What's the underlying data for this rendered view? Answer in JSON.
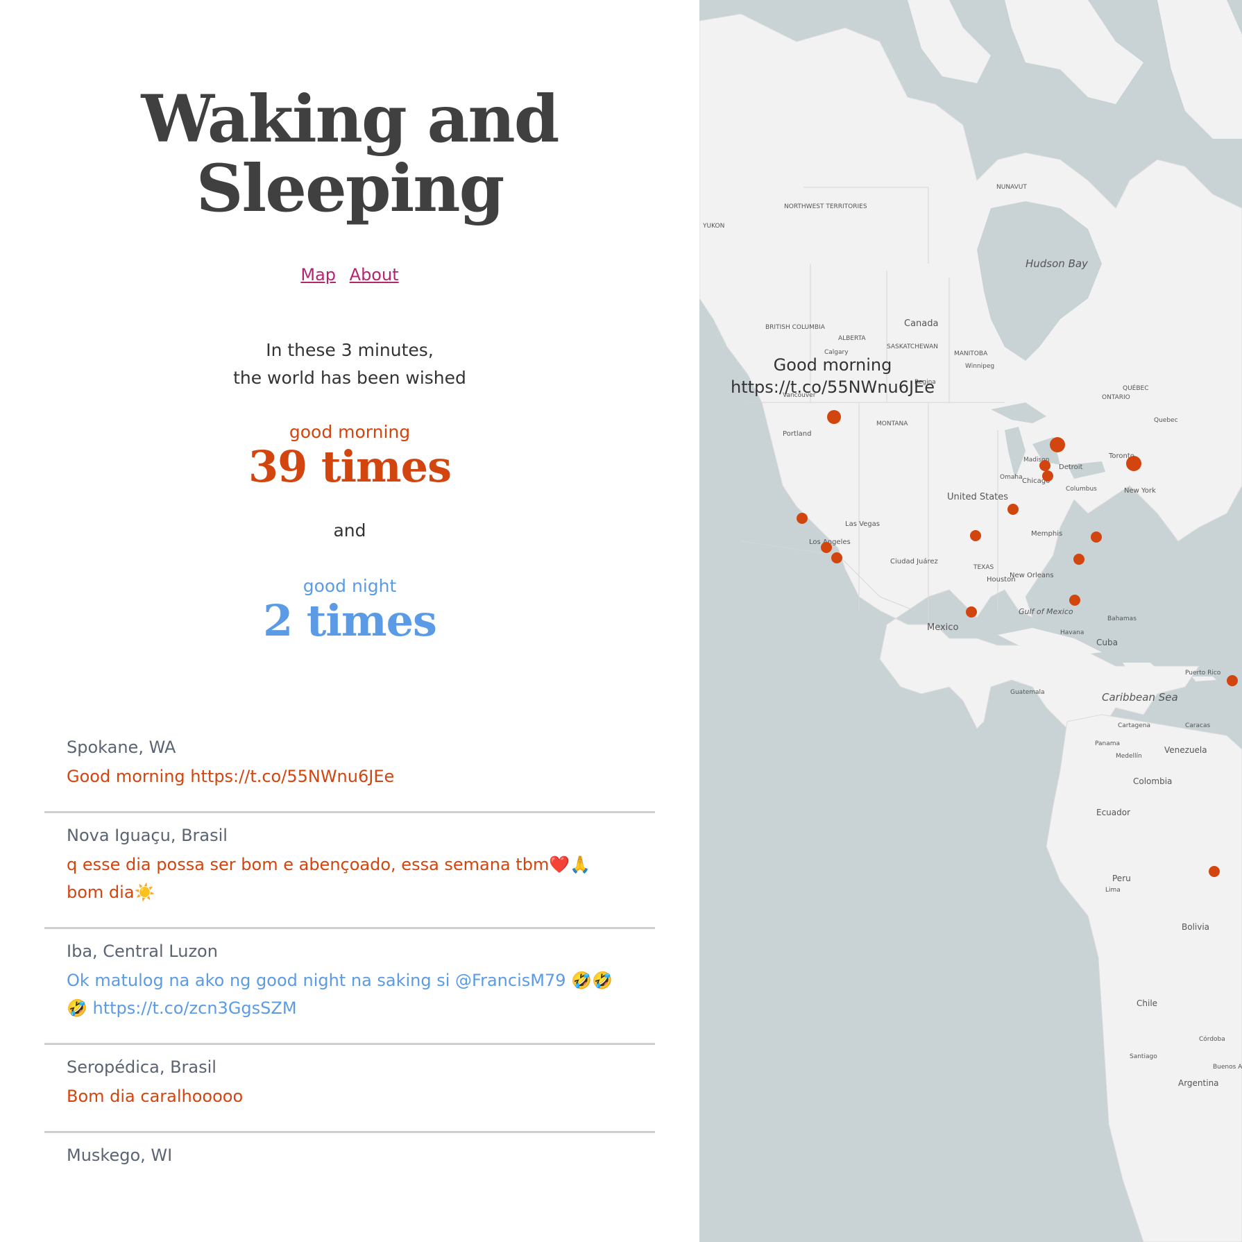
{
  "page": {
    "title_line1": "Waking and",
    "title_line2": "Sleeping",
    "nav": {
      "map": "Map",
      "about": "About"
    },
    "intro_line1": "In these 3 minutes,",
    "intro_line2": "the world has been wished",
    "good_morning_label": "good morning",
    "good_morning_count": "39 times",
    "and": "and",
    "good_night_label": "good night",
    "good_night_count": "2 times",
    "colors": {
      "morning": "#d2450f",
      "night": "#5b9be6",
      "link": "#b5256f"
    }
  },
  "feed": [
    {
      "place": "Spokane, WA",
      "message": "Good morning https://t.co/55NWnu6JEe",
      "type": "morning"
    },
    {
      "place": "Nova Iguaçu, Brasil",
      "message": "q esse dia possa ser bom e abençoado, essa semana tbm❤️🙏 bom dia☀️",
      "type": "morning"
    },
    {
      "place": "Iba, Central Luzon",
      "message": "Ok matulog na ako ng good night na saking si @FrancisM79 🤣🤣🤣 https://t.co/zcn3GgsSZM",
      "type": "night"
    },
    {
      "place": "Seropédica, Brasil",
      "message": "Bom dia caralhooooo",
      "type": "morning"
    },
    {
      "place": "Muskego, WI",
      "message": "",
      "type": "morning"
    }
  ],
  "map": {
    "tooltip": "Good morning https://t.co/55NWnu6JEe",
    "labels": {
      "canada": "Canada",
      "united_states": "United States",
      "mexico": "Mexico",
      "hudson_bay": "Hudson Bay",
      "gulf_mexico": "Gulf of Mexico",
      "caribbean": "Caribbean Sea",
      "cuba": "Cuba",
      "venezuela": "Venezuela",
      "colombia": "Colombia",
      "ecuador": "Ecuador",
      "peru": "Peru",
      "bolivia": "Bolivia",
      "chile": "Chile",
      "argentina": "Argentina",
      "toronto": "Toronto",
      "chicago": "Chicago",
      "detroit": "Detroit",
      "houston": "Houston",
      "las_vegas": "Las Vegas",
      "los_angeles": "Los Angeles",
      "portland": "Portland",
      "new_york": "New York",
      "memphis": "Memphis",
      "new_orleans": "New Orleans",
      "ciudad_juarez": "Ciudad Juárez",
      "winnipeg": "Winnipeg",
      "calgary": "Calgary",
      "regina": "Regina",
      "vancouver": "Vancouver",
      "havana": "Havana",
      "guatemala": "Guatemala",
      "panama": "Panama",
      "medellin": "Medellín",
      "lima": "Lima",
      "santiago": "Santiago",
      "quebec": "Quebec",
      "columbus": "Columbus",
      "omaha": "Omaha",
      "madison": "Madison",
      "montana": "MONTANA",
      "texas": "TEXAS",
      "ontario": "ONTARIO",
      "quebec_prov": "QUÉBEC",
      "nunavut": "NUNAVUT",
      "nwt": "NORTHWEST TERRITORIES",
      "yukon": "YUKON",
      "bc": "BRITISH COLUMBIA",
      "alberta": "ALBERTA",
      "saskatchewan": "SASKATCHEWAN",
      "manitoba": "MANITOBA",
      "bahamas": "Bahamas",
      "puerto_rico": "Puerto Rico",
      "caracas": "Caracas",
      "cartagena": "Cartagena",
      "cordoba": "Córdoba",
      "buenos_aires": "Buenos Aires"
    }
  }
}
